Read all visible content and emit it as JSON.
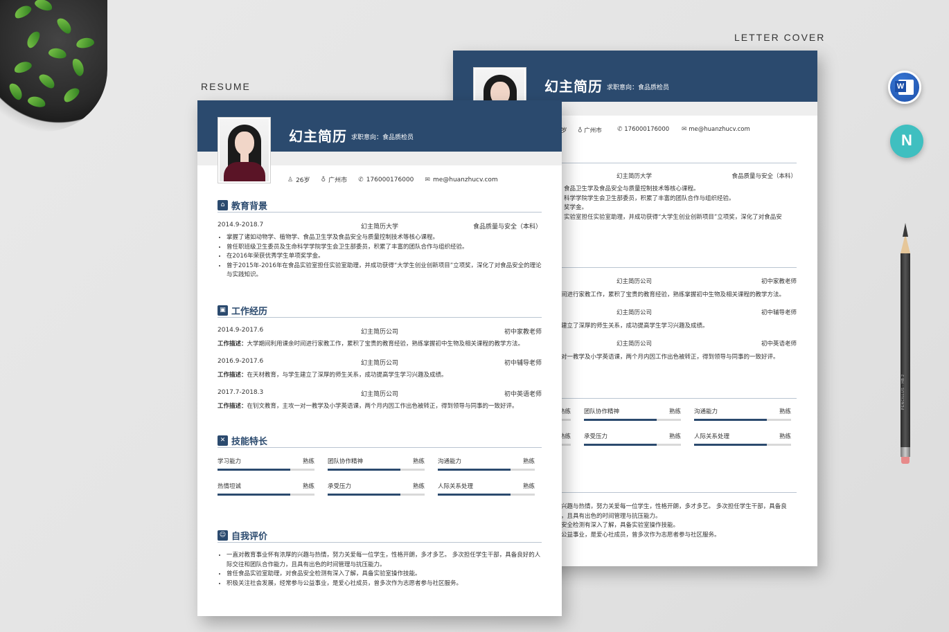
{
  "captions": {
    "resume": "RESUME",
    "letter_cover": "LETTER COVER"
  },
  "resume": {
    "name": "幻主简历",
    "intent": "求职意向：食品质检员",
    "info": {
      "age": "26岁",
      "city": "广州市",
      "phone": "176000176000",
      "email": "me@huanzhucv.com"
    },
    "education": {
      "title": "教育背景",
      "period": "2014.9-2018.7",
      "school": "幻主简历大学",
      "major": "食品质量与安全（本科）",
      "bullets": [
        "掌握了诸如动物学、植物学、食品卫生学及食品安全与质量控制技术等核心课程。",
        "曾任职班级卫生委员及生命科学学院学生会卫生部委员，积累了丰富的团队合作与组织经验。",
        "在2016年荣获优秀学生单项奖学金。",
        "曾于2015年-2016年在食品实验室担任实验室助理，并成功获得“大学生创业创新项目”立项奖，深化了对食品安全的理论与实践知识。"
      ]
    },
    "work": {
      "title": "工作经历",
      "desc_label": "工作描述：",
      "items": [
        {
          "period": "2014.9-2017.6",
          "company": "幻主简历公司",
          "role": "初中家教老师",
          "desc": "大学期间利用课余时间进行家教工作，累积了宝贵的教育经验，熟练掌握初中生物及相关课程的教学方法。"
        },
        {
          "period": "2016.9-2017.6",
          "company": "幻主简历公司",
          "role": "初中辅导老师",
          "desc": "在天材教育，与学生建立了深厚的师生关系，成功提高学生学习兴趣及成绩。"
        },
        {
          "period": "2017.7-2018.3",
          "company": "幻主简历公司",
          "role": "初中英语老师",
          "desc": "在钊文教育，主攻一对一教学及小学英语课，两个月内因工作出色被转正，得到领导与同事的一致好评。"
        }
      ]
    },
    "skills": {
      "title": "技能特长",
      "items": [
        {
          "name": "学习能力",
          "level": "熟练",
          "value": 0.75
        },
        {
          "name": "团队协作精神",
          "level": "熟练",
          "value": 0.75
        },
        {
          "name": "沟通能力",
          "level": "熟练",
          "value": 0.75
        },
        {
          "name": "热情坦诚",
          "level": "熟练",
          "value": 0.75
        },
        {
          "name": "承受压力",
          "level": "熟练",
          "value": 0.75
        },
        {
          "name": "人际关系处理",
          "level": "熟练",
          "value": 0.75
        }
      ]
    },
    "self_eval": {
      "title": "自我评价",
      "bullets": [
        "一直对教育事业怀有浓厚的兴趣与热情，努力关爱每一位学生，性格开朗，多才多艺。 多次担任学生干部，具备良好的人际交往和团队合作能力，且具有出色的时间管理与抗压能力。",
        "曾任食品实验室助理，对食品安全检测有深入了解，具备实验室操作技能。",
        "积极关注社会发展，经常参与公益事业，是爱心社成员，曾多次作为志愿者参与社区服务。"
      ]
    }
  },
  "cover": {
    "name": "幻主简历",
    "intent": "求职意向：食品质检员",
    "info_partial": {
      "age": "岁",
      "city": "广州市",
      "phone": "176000176000",
      "email": "me@huanzhucv.com"
    },
    "edu_school": "幻主简历大学",
    "edu_major": "食品质量与安全（本科）",
    "edu_lines": [
      "食品卫生学及食品安全与质量控制技术等核心课程。",
      "科学学院学生会卫生部委员，积累了丰富的团队合作与组织经验。",
      "奖学金。",
      "实验室担任实验室助理，并成功获得“大学生创业创新项目”立项奖，深化了对食品安"
    ],
    "work_rows": [
      {
        "company": "幻主简历公司",
        "role": "初中家教老师",
        "desc": "间进行家教工作，累积了宝贵的教育经验，熟练掌握初中生物及相关课程的教学方法。"
      },
      {
        "company": "幻主简历公司",
        "role": "初中辅导老师",
        "desc": "建立了深厚的师生关系，成功提高学生学习兴趣及成绩。"
      },
      {
        "company": "幻主简历公司",
        "role": "初中英语老师",
        "desc": "对一教学及小学英语课，两个月内因工作出色被转正，得到领导与同事的一致好评。"
      }
    ],
    "skills_row1": [
      {
        "name": "",
        "level": "熟练"
      },
      {
        "name": "团队协作精神",
        "level": "熟练"
      },
      {
        "name": "沟通能力",
        "level": "熟练"
      }
    ],
    "skills_row2": [
      {
        "name": "",
        "level": "熟练"
      },
      {
        "name": "承受压力",
        "level": "熟练"
      },
      {
        "name": "人际关系处理",
        "level": "熟练"
      }
    ],
    "eval_lines": [
      "兴趣与热情，努力关爱每一位学生，性格开朗，多才多艺。 多次担任学生干部，具备良",
      "，且具有出色的时间管理与抗压能力。",
      "安全检测有深入了解，具备实验室操作技能。",
      "公益事业，是爱心社成员，曾多次作为志愿者参与社区服务。"
    ]
  },
  "pencil_brand": "PENCILLUS · HB 2",
  "icons": {
    "word": "W",
    "nav": "N"
  },
  "colors": {
    "accent": "#2b4a6e",
    "bar": "#2b4a6e",
    "track": "#d9d9d9"
  }
}
